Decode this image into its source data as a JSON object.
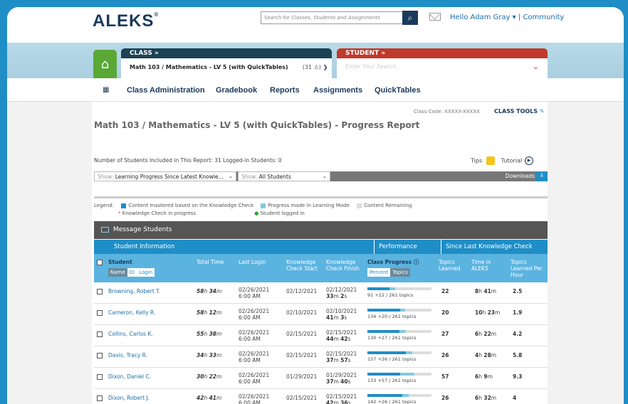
{
  "header": {
    "logo": "ALEKS",
    "logo_mark": "®",
    "search_placeholder": "Search for Classes, Students and Assignments",
    "greeting": "Hello Adam Gray ▾",
    "community": "Community"
  },
  "class_panel": {
    "label": "CLASS »",
    "name": "Math 103 / Mathematics - LV 5 (with QuickTables)",
    "count": "(31 ♙)"
  },
  "student_panel": {
    "label": "STUDENT »",
    "placeholder": "Enter Your Search"
  },
  "nav": [
    "Class Administration",
    "Gradebook",
    "Reports",
    "Assignments",
    "QuickTables"
  ],
  "report": {
    "class_code": "Class Code: XXXXX-XXXXX",
    "class_tools": "CLASS TOOLS",
    "title": "Math 103 / Mathematics - LV 5 (with QuickTables) - Progress Report",
    "info": "Number of Students Included in This Report: 31    Logged-in Students: 0",
    "tips": "Tips",
    "tutorial": "Tutorial",
    "filter1_label": "Show:",
    "filter1_value": "Learning Progress Since Latest Knowle...",
    "filter2_label": "Show:",
    "filter2_value": "All Students",
    "downloads": "Downloads"
  },
  "legend": {
    "label": "Legend:",
    "mastered": "Content mastered based on the Knowledge Check",
    "progress": "Progress made in Learning Mode",
    "remaining": "Content Remaining",
    "kc_progress": "Knowledge Check in progress",
    "logged_in": "Student logged in"
  },
  "table": {
    "message": "Message Students",
    "group_student_info": "Student Information",
    "group_performance": "Performance",
    "group_since": "Since Last Knowledge Check",
    "col_student": "Student",
    "toggle_name": "Name",
    "toggle_id": "ID",
    "toggle_login": "Login",
    "col_total": "Total Time",
    "col_last_login": "Last Login",
    "col_kc_start": "Knowledge Check Start",
    "col_kc_finish": "Knowledge Check Finish",
    "col_progress": "Class Progress ⓘ",
    "toggle_percent": "Percent",
    "toggle_topics": "Topics",
    "col_topics_learned": "Topics Learned",
    "col_time_aleks": "Time in ALEKS",
    "col_per_hour": "Topics Learned Per Hour"
  },
  "colors": {
    "mastered": "#1f8ec6",
    "progress": "#7fcbe0",
    "remaining": "#dddddd"
  },
  "rows": [
    {
      "name": "Browning, Robert T.",
      "total_h": "58",
      "total_m": "34",
      "login": "02/26/2021",
      "login_time": "6:00 AM",
      "kc_start": "02/12/2021",
      "kc_finish": "02/12/2021",
      "fin_m": "33",
      "fin_s": "2",
      "progress": "91 +22 / 261 topics",
      "mastered": 91,
      "gained": 22,
      "total": 261,
      "learned": "22",
      "al_h": "8",
      "al_m": "41",
      "rate": "2.5"
    },
    {
      "name": "Cameron, Kelly R.",
      "total_h": "58",
      "total_m": "12",
      "login": "02/26/2021",
      "login_time": "6:00 AM",
      "kc_start": "02/10/2021",
      "kc_finish": "02/10/2021",
      "fin_m": "41",
      "fin_s": "3",
      "progress": "134 +20 / 261 topics",
      "mastered": 134,
      "gained": 20,
      "total": 261,
      "learned": "20",
      "al_h": "10",
      "al_m": "23",
      "rate": "1.9"
    },
    {
      "name": "Collins, Carlos K.",
      "total_h": "55",
      "total_m": "38",
      "login": "02/26/2021",
      "login_time": "6:00 AM",
      "kc_start": "02/15/2021",
      "kc_finish": "02/15/2021",
      "fin_m": "44",
      "fin_s": "42",
      "progress": "130 +27 / 261 topics",
      "mastered": 130,
      "gained": 27,
      "total": 261,
      "learned": "27",
      "al_h": "6",
      "al_m": "22",
      "rate": "4.2"
    },
    {
      "name": "Davis, Tracy R.",
      "total_h": "34",
      "total_m": "33",
      "login": "02/26/2021",
      "login_time": "6:00 AM",
      "kc_start": "02/15/2021",
      "kc_finish": "02/15/2021",
      "fin_m": "37",
      "fin_s": "57",
      "progress": "157 +26 / 261 topics",
      "mastered": 157,
      "gained": 26,
      "total": 261,
      "learned": "26",
      "al_h": "4",
      "al_m": "28",
      "rate": "5.8"
    },
    {
      "name": "Dixon, Daniel C.",
      "total_h": "30",
      "total_m": "22",
      "login": "02/26/2021",
      "login_time": "6:00 AM",
      "kc_start": "01/29/2021",
      "kc_finish": "01/29/2021",
      "fin_m": "37",
      "fin_s": "40",
      "progress": "133 +57 / 261 topics",
      "mastered": 133,
      "gained": 57,
      "total": 261,
      "learned": "57",
      "al_h": "6",
      "al_m": "9",
      "rate": "9.3"
    },
    {
      "name": "Dixon, Robert J.",
      "total_h": "42",
      "total_m": "41",
      "login": "02/26/2021",
      "login_time": "6:00 AM",
      "kc_start": "02/15/2021",
      "kc_finish": "02/15/2021",
      "fin_m": "42",
      "fin_s": "36",
      "progress": "142 +26 / 261 topics",
      "mastered": 142,
      "gained": 26,
      "total": 261,
      "learned": "26",
      "al_h": "6",
      "al_m": "32",
      "rate": "4"
    }
  ]
}
